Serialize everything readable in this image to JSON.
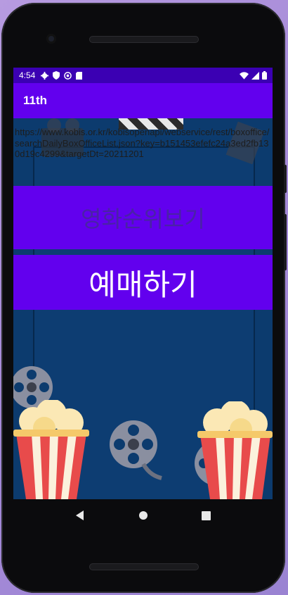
{
  "status_bar": {
    "time": "4:54",
    "left_icons": [
      "gear-icon",
      "shield-icon",
      "vpn-icon",
      "sd-card-icon"
    ],
    "right_icons": [
      "wifi-icon",
      "signal-icon",
      "battery-icon"
    ]
  },
  "app_bar": {
    "title": "11th"
  },
  "url_text": "https://www.kobis.or.kr/kobisopenapi/webservice/rest/boxoffice/searchDailyBoxOfficeList.json?key=b151453efefc24a3ed2fb130d19c4299&targetDt=20211201",
  "buttons": {
    "rank_label": "영화순위보기",
    "reserve_label": "예매하기"
  },
  "nav_bar": {
    "icons": [
      "back-icon",
      "home-icon",
      "recents-icon"
    ]
  },
  "colors": {
    "status_bar": "#3b00b3",
    "accent": "#6200ee",
    "background": "#0c3b6e"
  }
}
